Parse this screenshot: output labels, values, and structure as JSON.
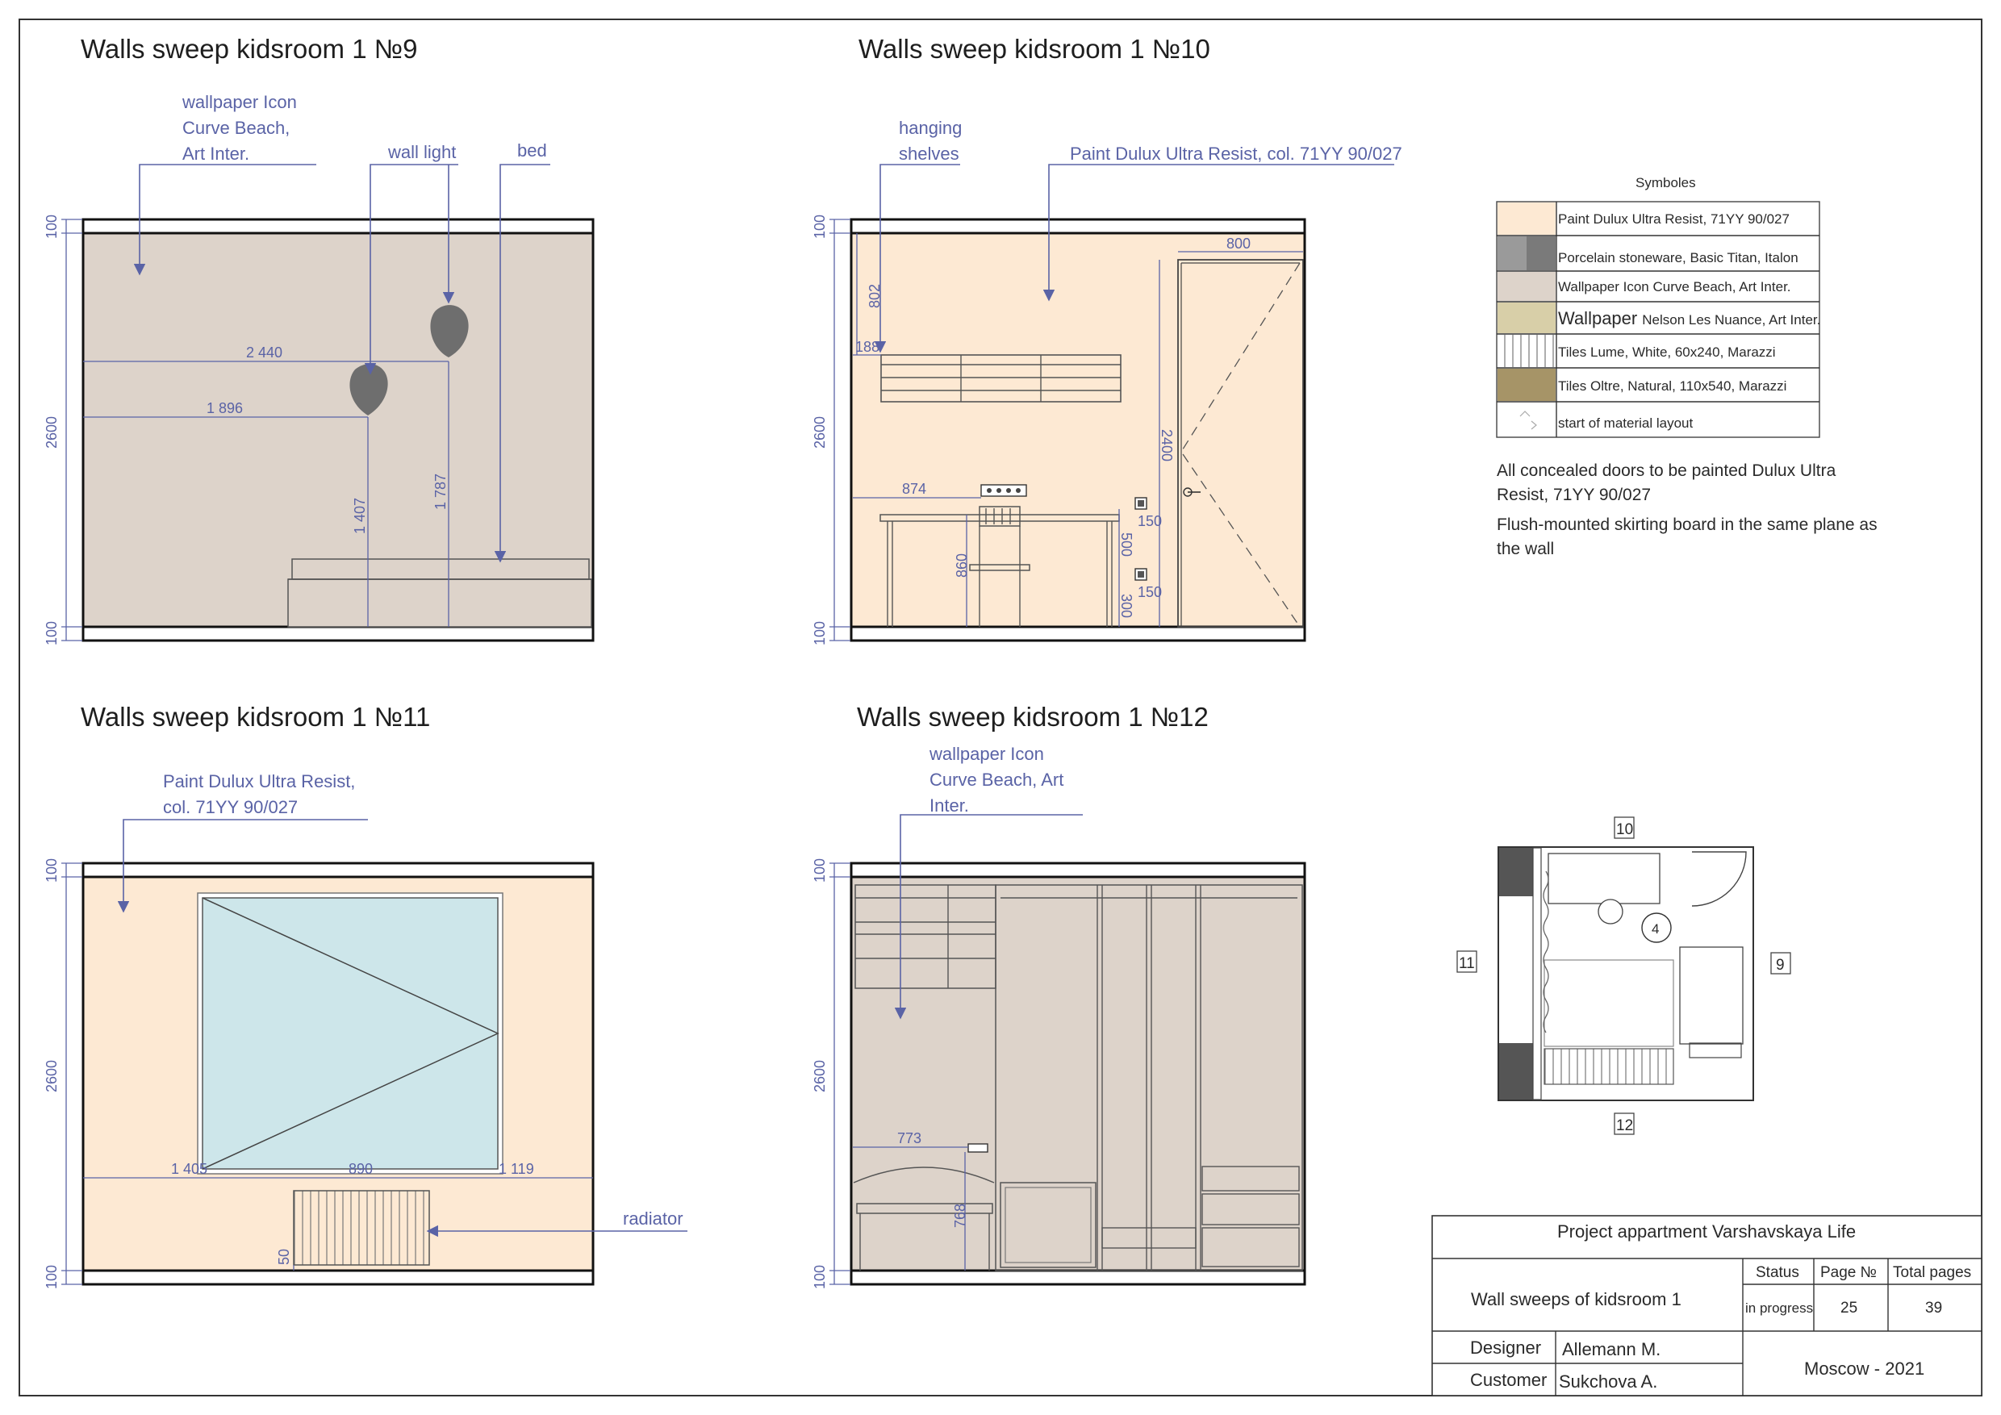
{
  "views": {
    "v9": {
      "title": "Walls sweep kidsroom 1 №9",
      "notes": {
        "wallpaper": [
          "wallpaper Icon",
          "Curve Beach,",
          "Art Inter."
        ],
        "wall_light": "wall light",
        "bed": "bed"
      },
      "dims": {
        "top": "100",
        "height": "2600",
        "bottom": "100",
        "w2440": "2 440",
        "w1896": "1 896",
        "h1407": "1 407",
        "h1787": "1 787"
      }
    },
    "v10": {
      "title": "Walls sweep kidsroom 1 №10",
      "notes": {
        "shelves": [
          "hanging",
          "shelves"
        ],
        "paint": "Paint Dulux Ultra Resist, col. 71YY 90/027"
      },
      "dims": {
        "top": "100",
        "height": "2600",
        "bottom": "100",
        "d802": "802",
        "d188": "188",
        "d874": "874",
        "d860": "860",
        "d800": "800",
        "d2400": "2400",
        "d500": "500",
        "d300": "300",
        "d150a": "150",
        "d150b": "150"
      }
    },
    "v11": {
      "title": "Walls sweep kidsroom 1 №11",
      "notes": {
        "paint": [
          "Paint Dulux Ultra Resist,",
          "col. 71YY 90/027"
        ],
        "radiator": "radiator"
      },
      "dims": {
        "top": "100",
        "height": "2600",
        "bottom": "100",
        "d1405": "1 405",
        "d890": "890",
        "d1119": "1 119",
        "d50": "50"
      }
    },
    "v12": {
      "title": "Walls sweep kidsroom 1 №12",
      "notes": {
        "wallpaper": [
          "wallpaper Icon",
          "Curve Beach, Art",
          "Inter."
        ]
      },
      "dims": {
        "top": "100",
        "height": "2600",
        "bottom": "100",
        "d773": "773",
        "d768": "768"
      }
    }
  },
  "legend": {
    "title": "Symboles",
    "items": [
      {
        "label": "Paint Dulux Ultra Resist, 71YY 90/027",
        "swatch": "#fde9d3"
      },
      {
        "label": "Porcelain stoneware, Basic Titan, Italon",
        "swatch": "#9a9a9a"
      },
      {
        "label": "Wallpaper Icon Curve Beach, Art  Inter.",
        "swatch": "#ddd3ca"
      },
      {
        "label_big": "Wallpaper",
        "label": "Nelson Les Nuance, Art Inter.",
        "swatch": "#d8cfa8"
      },
      {
        "label": "Tiles Lume, White, 60x240, Marazzi",
        "swatch": "#eef1f3"
      },
      {
        "label": "Tiles Oltre, Natural, 110x540, Marazzi",
        "swatch": "#a69467"
      },
      {
        "label": "start of material layout",
        "swatch": "#ffffff"
      }
    ]
  },
  "notes": [
    [
      "All concealed doors to be painted Dulux Ultra",
      "Resist, 71YY 90/027"
    ],
    [
      "Flush-mounted skirting board in the same plane as",
      "the wall"
    ]
  ],
  "plan": {
    "labels": {
      "top": "10",
      "right": "9",
      "bottom": "12",
      "left": "11",
      "room": "4"
    }
  },
  "title_block": {
    "project": "Project appartment Varshavskaya Life",
    "sheet_name": "Wall sweeps of kidsroom 1",
    "status_label": "Status",
    "status": "in progress",
    "page_label": "Page №",
    "page": "25",
    "total_label": "Total pages",
    "total": "39",
    "designer_label": "Designer",
    "designer": "Allemann M.",
    "customer_label": "Customer",
    "customer": "Sukchova A.",
    "city_year": "Moscow - 2021"
  },
  "colors": {
    "paint": "#fde9d3",
    "wallpaper": "#ddd3ca",
    "glass": "#cde6ea",
    "annotation": "#5a63a6",
    "lamp": "#6e6e6e"
  }
}
